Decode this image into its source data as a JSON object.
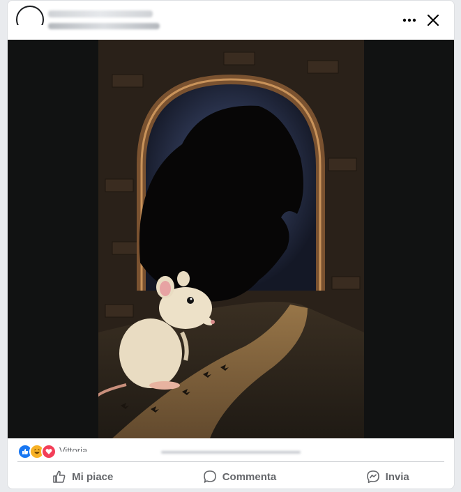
{
  "post": {
    "reactions": {
      "types": [
        "like-icon",
        "haha-icon",
        "love-icon"
      ],
      "reactor_name": "Vittoria"
    },
    "actions": {
      "like_label": "Mi piace",
      "comment_label": "Commenta",
      "share_label": "Invia"
    }
  },
  "colors": {
    "like_blue": "#1877f2",
    "love_red": "#f33e58",
    "haha_yellow": "#f7b125",
    "text_secondary": "#65676b"
  }
}
